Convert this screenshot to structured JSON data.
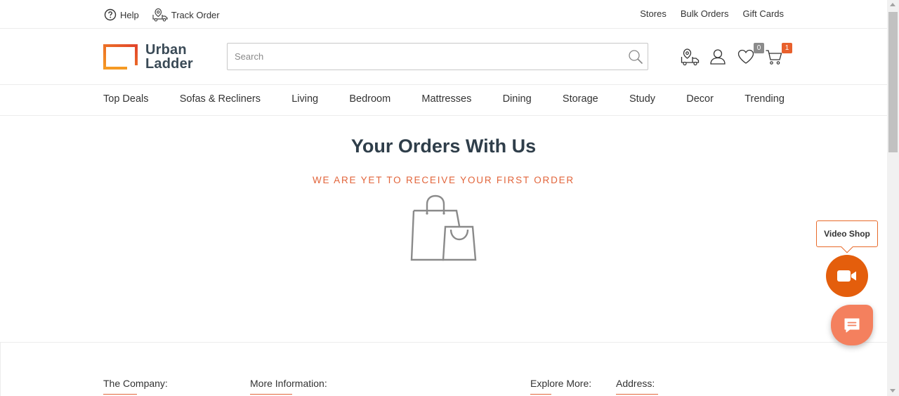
{
  "utility_bar": {
    "help_label": "Help",
    "help_icon": "question-circle-icon",
    "track_order_label": "Track Order",
    "track_order_icon": "delivery-truck-icon",
    "right_links": [
      "Stores",
      "Bulk Orders",
      "Gift Cards"
    ]
  },
  "header": {
    "logo_line1": "Urban",
    "logo_line2": "Ladder",
    "search_placeholder": "Search",
    "wishlist_count": "0",
    "cart_count": "1",
    "icons": [
      "track-truck-icon",
      "user-icon",
      "heart-icon",
      "cart-icon"
    ]
  },
  "nav": {
    "items": [
      "Top Deals",
      "Sofas & Recliners",
      "Living",
      "Bedroom",
      "Mattresses",
      "Dining",
      "Storage",
      "Study",
      "Decor",
      "Trending"
    ]
  },
  "main": {
    "title": "Your Orders With Us",
    "subtitle": "WE ARE YET TO RECEIVE YOUR FIRST ORDER",
    "illustration": "shopping-bags-icon"
  },
  "footer": {
    "columns": [
      "The Company:",
      "More Information:",
      "Explore More:",
      "Address:"
    ]
  },
  "widgets": {
    "video_shop_label": "Video Shop"
  },
  "colors": {
    "accent": "#e2643a",
    "brand_orange": "#e45e0c",
    "chat": "#f4805e",
    "text_dark": "#2f3e4a"
  }
}
